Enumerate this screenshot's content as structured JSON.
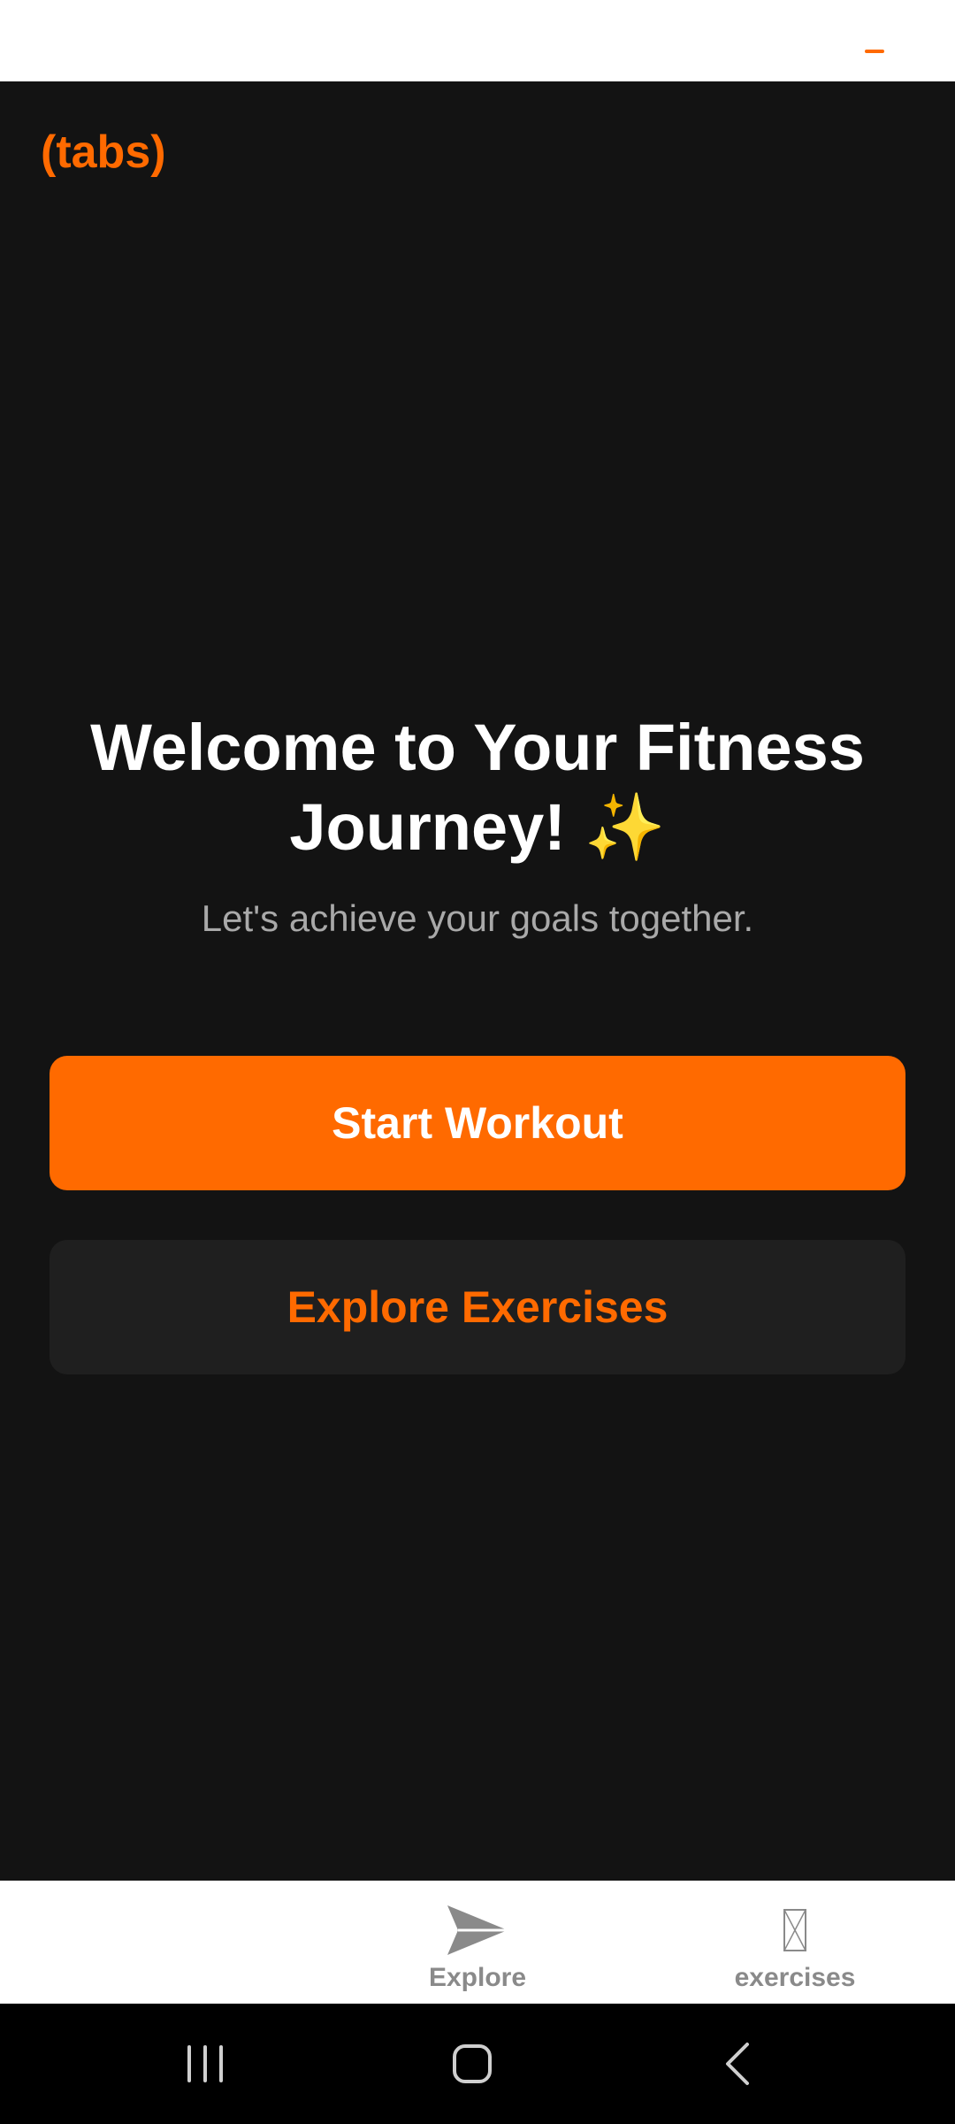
{
  "header": {
    "title": "(tabs)"
  },
  "hero": {
    "title": "Welcome to Your Fitness Journey! ✨",
    "subtitle": "Let's achieve your goals together."
  },
  "actions": {
    "primary_label": "Start Workout",
    "secondary_label": "Explore Exercises"
  },
  "tabs": [
    {
      "label": "Explore",
      "icon": "send-icon"
    },
    {
      "label": "exercises",
      "icon": "missing-glyph-icon"
    }
  ],
  "system_nav": {
    "buttons": [
      "recents-icon",
      "home-icon",
      "back-icon"
    ]
  },
  "colors": {
    "accent": "#ff6a00",
    "background": "#131313",
    "secondary_button": "#1f1f1f",
    "tab_bar": "#ffffff",
    "tab_label": "#8a8a8a"
  }
}
